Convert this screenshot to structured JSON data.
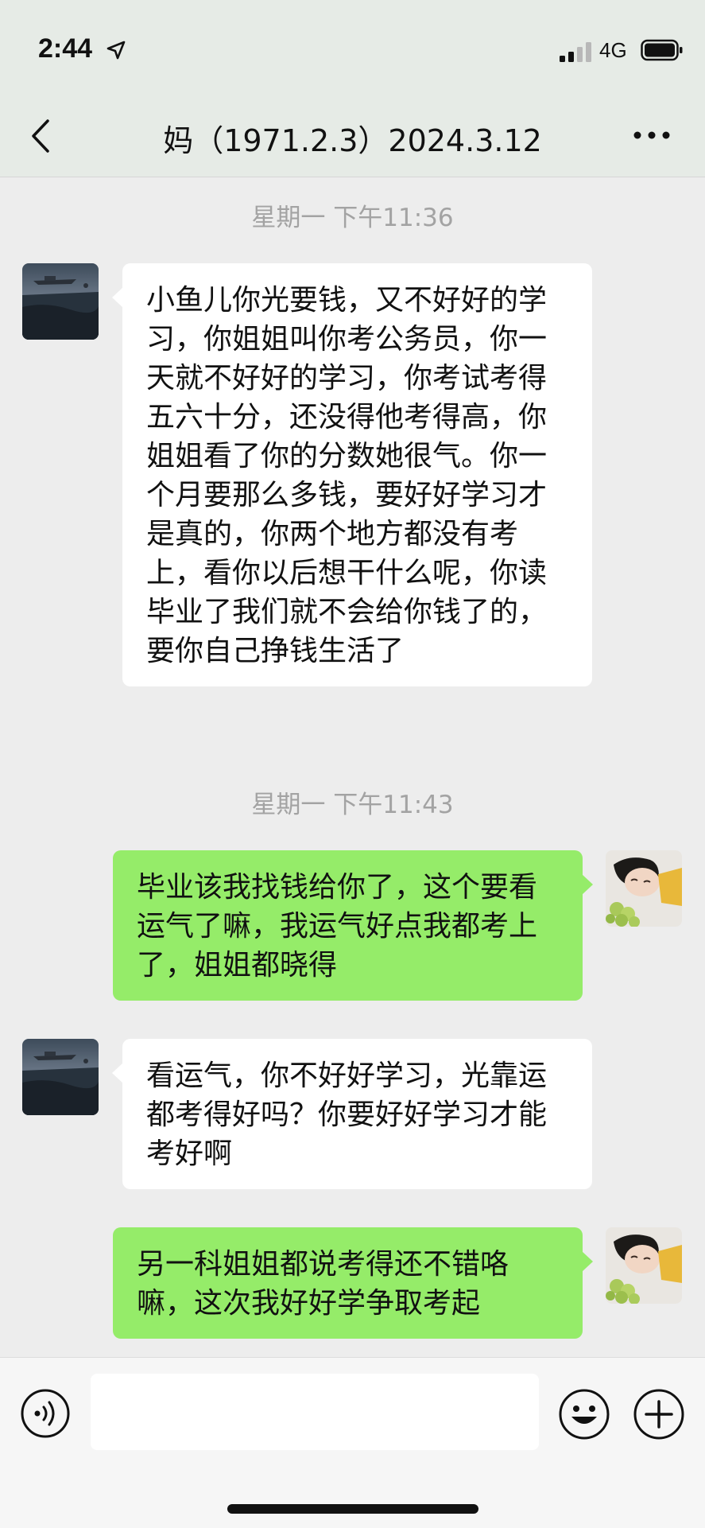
{
  "status_bar": {
    "time": "2:44",
    "network": "4G"
  },
  "header": {
    "title": "妈（1971.2.3）2024.3.12"
  },
  "timestamps": [
    "星期一 下午11:36",
    "星期一 下午11:43"
  ],
  "messages": [
    {
      "side": "left",
      "text": "小鱼儿你光要钱，又不好好的学习，你姐姐叫你考公务员，你一天就不好好的学习，你考试考得五六十分，还没得他考得高，你姐姐看了你的分数她很气。你一个月要那么多钱，要好好学习才是真的，你两个地方都没有考上，看你以后想干什么呢，你读毕业了我们就不会给你钱了的，要你自己挣钱生活了"
    },
    {
      "side": "right",
      "text": "毕业该我找钱给你了，这个要看运气了嘛，我运气好点我都考上了，姐姐都晓得"
    },
    {
      "side": "left",
      "text": "看运气，你不好好学习，光靠运都考得好吗？你要好好学习才能考好啊"
    },
    {
      "side": "right",
      "text": "另一科姐姐都说考得还不错咯嘛，这次我好好学争取考起"
    }
  ],
  "colors": {
    "bubble_sent": "#95ec69",
    "bubble_received": "#ffffff",
    "background": "#ededed"
  },
  "input_bar": {
    "placeholder": "",
    "value": ""
  }
}
